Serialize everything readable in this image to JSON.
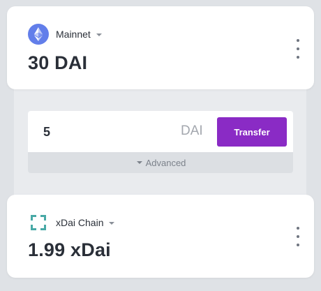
{
  "networks": [
    {
      "name": "Mainnet",
      "icon": "ethereum-icon",
      "balance": "30 DAI",
      "icon_color": "#627eea"
    },
    {
      "name": "xDai Chain",
      "icon": "xdai-icon",
      "balance": "1.99 xDai",
      "icon_color": "#48a9a6"
    }
  ],
  "transfer": {
    "amount_value": "5",
    "unit": "DAI",
    "button_label": "Transfer",
    "button_color": "#8a2bc5",
    "advanced_label": "Advanced"
  }
}
